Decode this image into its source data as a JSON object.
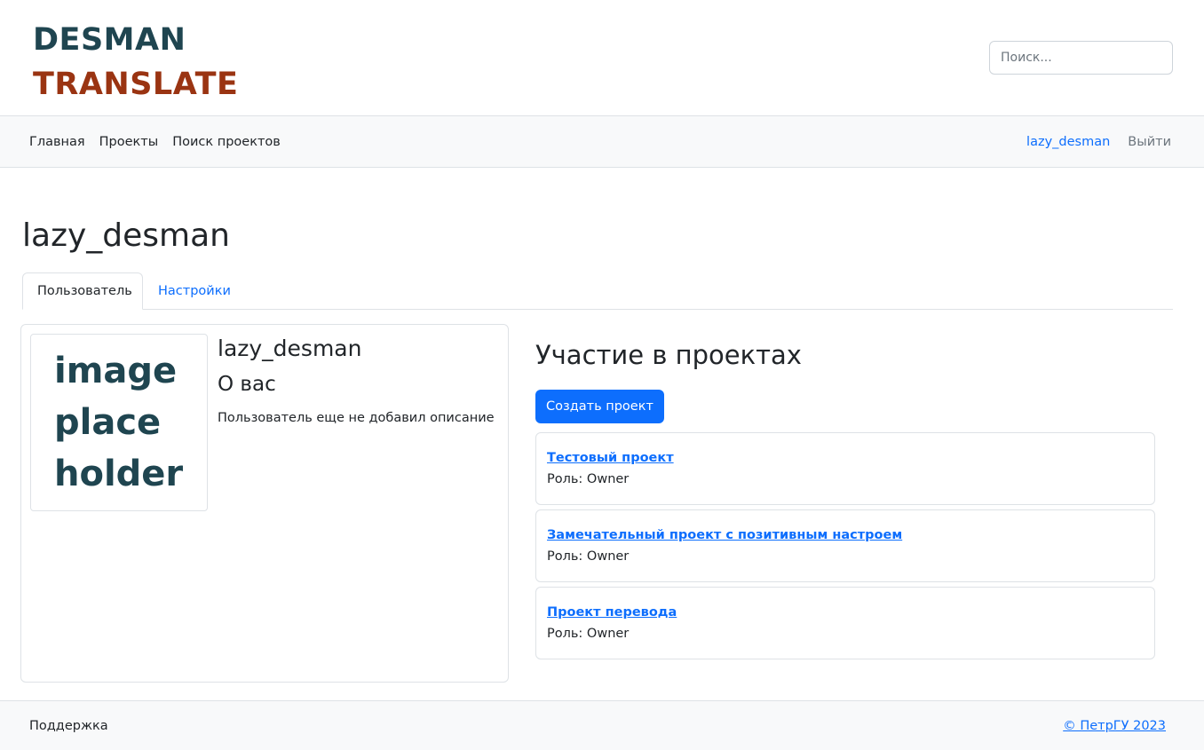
{
  "header": {
    "logo_line1": "DESMAN",
    "logo_line2": "TRANSLATE",
    "search_placeholder": "Поиск..."
  },
  "nav": {
    "items": [
      {
        "label": "Главная"
      },
      {
        "label": "Проекты"
      },
      {
        "label": "Поиск проектов"
      }
    ],
    "username": "lazy_desman",
    "logout": "Выйти"
  },
  "page": {
    "title": "lazy_desman"
  },
  "tabs": [
    {
      "label": "Пользователь",
      "active": true
    },
    {
      "label": "Настройки",
      "active": false
    }
  ],
  "profile": {
    "avatar_text": [
      "image",
      "place",
      "holder"
    ],
    "name": "lazy_desman",
    "about_title": "О вас",
    "about_text": "Пользователь еще не добавил описание"
  },
  "projects": {
    "title": "Участие в проектах",
    "create_button": "Создать проект",
    "items": [
      {
        "name": "Тестовый проект",
        "role": "Роль: Owner"
      },
      {
        "name": "Замечательный проект с позитивным настроем",
        "role": "Роль: Owner"
      },
      {
        "name": "Проект перевода",
        "role": "Роль: Owner"
      }
    ]
  },
  "footer": {
    "support": "Поддержка",
    "copyright": "© ПетрГУ 2023"
  },
  "colors": {
    "accent": "#0d6efd",
    "logo_dark": "#1f4550",
    "logo_rust": "#9a3412"
  }
}
